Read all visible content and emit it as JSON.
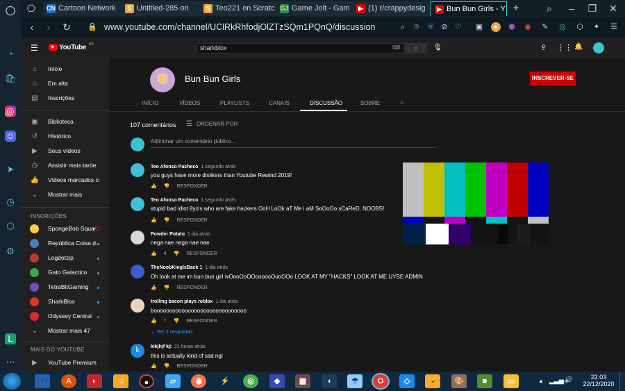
{
  "browser": {
    "tabs": [
      {
        "label": "Cartoon Network",
        "fav": "CN",
        "color": "#1a6fd1"
      },
      {
        "label": "Untitled-285 on",
        "fav": "S",
        "color": "#f2a640"
      },
      {
        "label": "Teo221 on Scratc",
        "fav": "S",
        "color": "#f2a640"
      },
      {
        "label": "Game Jolt - Gam",
        "fav": "GJ",
        "color": "#2f7f6e"
      },
      {
        "label": "(1) r/crappydesig",
        "fav": "▶",
        "color": "#e00000"
      },
      {
        "label": "Bun Bun Girls - Y",
        "fav": "▶",
        "color": "#e00000"
      }
    ],
    "new_tab": "+",
    "url": "www.youtube.com/channel/UClRkRhfodjOlZTzSQm1PQnQ/discussion"
  },
  "youtube": {
    "logo_text": "YouTube",
    "logo_region": "BR",
    "search_value": "sharkblox",
    "sidebar": {
      "main": [
        {
          "label": "Início",
          "icon": "home-icon",
          "glyph": "⌂"
        },
        {
          "label": "Em alta",
          "icon": "flame-icon",
          "glyph": "♨"
        },
        {
          "label": "Inscrições",
          "icon": "subscriptions-icon",
          "glyph": "▤"
        }
      ],
      "library": [
        {
          "label": "Biblioteca",
          "icon": "library-icon",
          "glyph": "▣"
        },
        {
          "label": "Histórico",
          "icon": "history-icon",
          "glyph": "↺"
        },
        {
          "label": "Seus vídeos",
          "icon": "your-videos-icon",
          "glyph": "▶"
        },
        {
          "label": "Assistir mais tarde",
          "icon": "clock-icon",
          "glyph": "◷"
        },
        {
          "label": "Vídeos marcados co...",
          "icon": "thumbs-up-icon",
          "glyph": "👍"
        },
        {
          "label": "Mostrar mais",
          "icon": "chevron-down-icon",
          "glyph": "⌄"
        }
      ],
      "subscriptions_heading": "INSCRIÇÕES",
      "subscriptions": [
        {
          "label": "SpongeBob Squar...",
          "color": "#f5d142",
          "badge": "live"
        },
        {
          "label": "República Coisa d...",
          "color": "#4a7fb5",
          "badge": "dot"
        },
        {
          "label": "Logdotzip",
          "color": "#c0392b",
          "badge": "dot"
        },
        {
          "label": "Gato Galactico",
          "color": "#3ea650",
          "badge": "dot"
        },
        {
          "label": "TetraBitGaming",
          "color": "#6b4fbb",
          "badge": "dot"
        },
        {
          "label": "SharkBlox",
          "color": "#d9381e",
          "badge": "dot"
        },
        {
          "label": "Odyssey Central",
          "color": "#d62b2b",
          "badge": "dot"
        }
      ],
      "show_more_subs": "Mostrar mais 47",
      "more_heading": "MAIS DO YOUTUBE",
      "premium": "YouTube Premium"
    },
    "channel": {
      "name": "Bun Bun Girls",
      "subscribe": "INSCREVER-SE",
      "tabs": [
        "INÍCIO",
        "VÍDEOS",
        "PLAYLISTS",
        "CANAIS",
        "DISCUSSÃO",
        "SOBRE"
      ],
      "active_tab": "DISCUSSÃO"
    },
    "discussion": {
      "count": "107 comentários",
      "sort": "ORDENAR POR",
      "add_placeholder": "Adicionar um comentário público...",
      "reply_label": "RESPONDER",
      "comments": [
        {
          "author": "Teo Afonso Pacheco",
          "time": "1 segundo atrás",
          "text": "you guys have more dislikers than Youtube Rewind 2019!",
          "likes": "",
          "color": "#3ec1d3"
        },
        {
          "author": "Teo Afonso Pacheco",
          "time": "1 segundo atrás",
          "text": "stupid bad idiot 8yo's who are fake hackers OoH LoOk aT Me i aM SoOoOo sCaReD, NOOBS!",
          "likes": "",
          "color": "#3ec1d3"
        },
        {
          "author": "Powder Potato",
          "time": "1 dia atrás",
          "text": "nega nae nega nae nae",
          "likes": "4",
          "color": "#d8d8d8"
        },
        {
          "author": "TheNoobKingIsBack 1",
          "time": "1 dia atrás",
          "text": "Oh look at me im bun bun girl wOooOoOOoooooOooOOo LOOK AT MY \"HACKS\" LOOK AT ME UYSE ADMIN",
          "likes": "",
          "color": "#3a5fc8"
        },
        {
          "author": "trolling bacon plays roblox",
          "time": "1 dia atrás",
          "text": "boooooooooooooooooooooooooooooo",
          "likes": "7",
          "color": "#e8d5c0"
        },
        {
          "author": "kikjhjf kji",
          "time": "21 horas atrás",
          "text": "this is actually kind of sad ngl",
          "likes": "",
          "color": "#1e88e5",
          "initial": "k"
        }
      ],
      "replies_toggle": "Ver 2 respostas"
    }
  },
  "taskbar": {
    "time": "22:03",
    "date": "22/12/2020"
  }
}
